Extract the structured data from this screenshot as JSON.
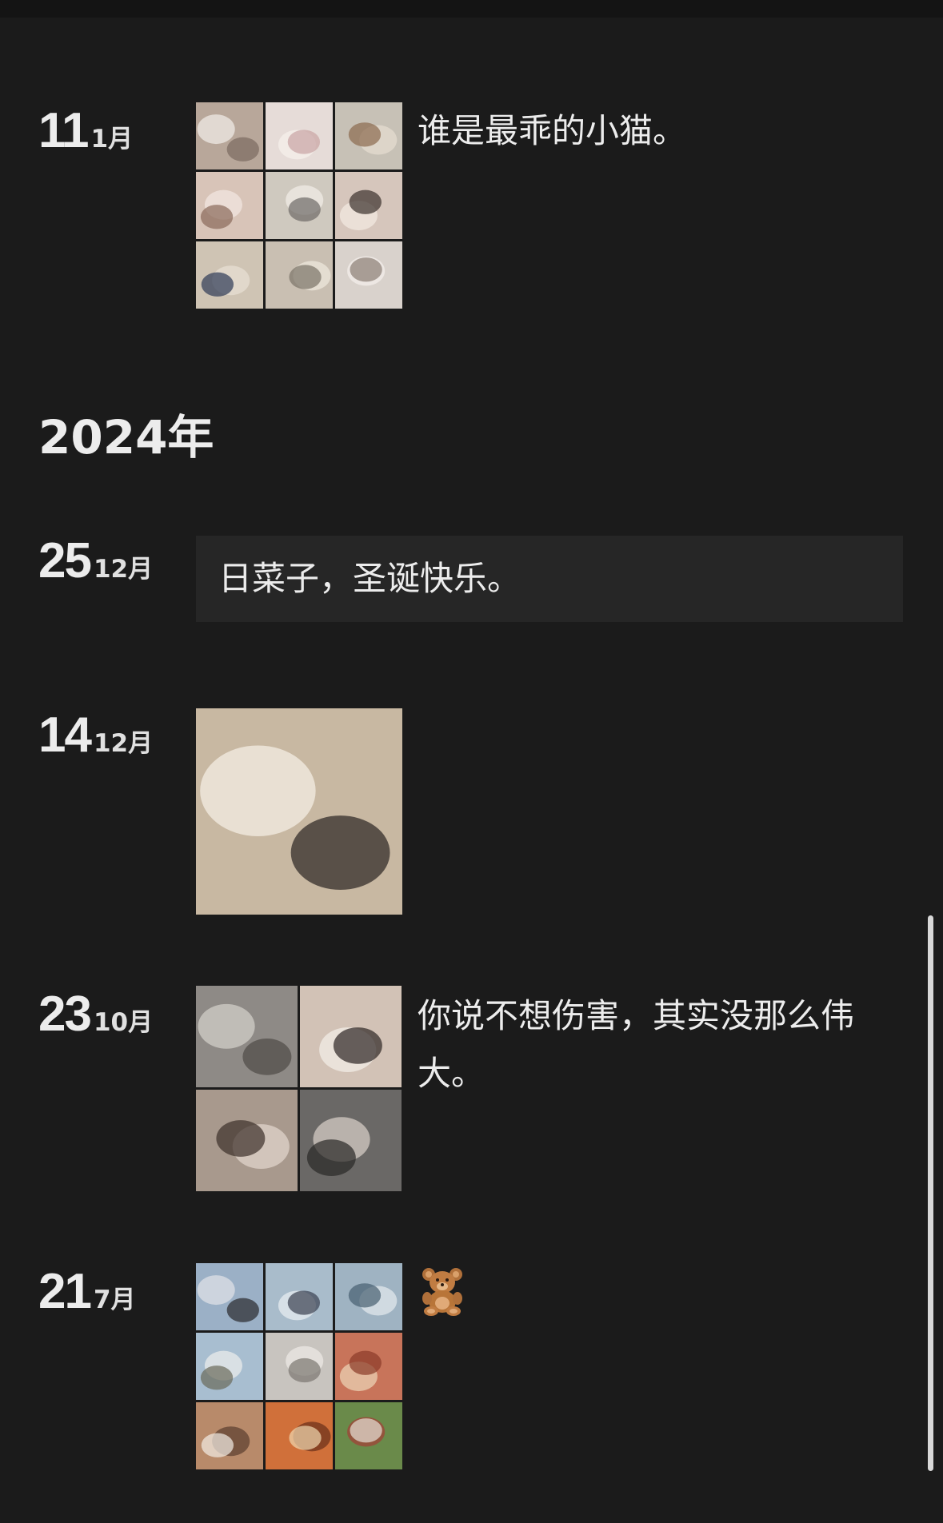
{
  "timeline": {
    "entries_2025": [
      {
        "day": "11",
        "month": "1月",
        "caption": "谁是最乖的小猫。",
        "photos": [
          {
            "name": "photo-cat-kitten",
            "colors": [
              "#b8a79a",
              "#7a6a60",
              "#e8e2dc"
            ]
          },
          {
            "name": "photo-cat-face-closeup",
            "colors": [
              "#e6dcd8",
              "#c9a4a4",
              "#f3ede9"
            ]
          },
          {
            "name": "photo-calico-cat",
            "colors": [
              "#c7c1b6",
              "#8b6a4e",
              "#e0d8cc"
            ]
          },
          {
            "name": "photo-girl-selfie",
            "colors": [
              "#d8c4b8",
              "#8a6a5a",
              "#efe2da"
            ]
          },
          {
            "name": "photo-polaroids",
            "colors": [
              "#cfc9bf",
              "#6d6a66",
              "#ece8e1"
            ]
          },
          {
            "name": "photo-girl-with-cat",
            "colors": [
              "#d6c6bc",
              "#3a302c",
              "#eee4dc"
            ]
          },
          {
            "name": "photo-boy-with-cat",
            "colors": [
              "#cfc4b4",
              "#2e3a55",
              "#e4dccf"
            ]
          },
          {
            "name": "photo-cat-on-blanket",
            "colors": [
              "#c9bfb2",
              "#7b7468",
              "#e9e2d6"
            ]
          },
          {
            "name": "photo-cat-sleeping",
            "colors": [
              "#d9d2cc",
              "#8a7d74",
              "#f0ebe6"
            ]
          }
        ]
      }
    ],
    "year_label": "2024年",
    "entries_2024": [
      {
        "day": "25",
        "month": "12月",
        "text": "日菜子，圣诞快乐。"
      },
      {
        "day": "14",
        "month": "12月",
        "photos": [
          {
            "name": "photo-girl-with-cats-cafe",
            "colors": [
              "#c8b8a2",
              "#2a2422",
              "#eee6dc"
            ]
          }
        ]
      },
      {
        "day": "23",
        "month": "10月",
        "caption": "你说不想伤害，其实没那么伟大。",
        "photos": [
          {
            "name": "photo-cat-and-feet",
            "colors": [
              "#8e8a86",
              "#4e4a46",
              "#c9c5c0"
            ]
          },
          {
            "name": "photo-girl-lying",
            "colors": [
              "#d2c2b6",
              "#2c2524",
              "#efe7e0"
            ]
          },
          {
            "name": "photo-mirror-selfie",
            "colors": [
              "#a8998d",
              "#3c2f2a",
              "#d9cdc3"
            ]
          },
          {
            "name": "photo-cat-and-hand",
            "colors": [
              "#6a6866",
              "#2a2827",
              "#c7bfb8"
            ]
          }
        ]
      },
      {
        "day": "21",
        "month": "7月",
        "emoji": "🧸",
        "emoji_name": "teddy-bear-icon",
        "photos": [
          {
            "name": "photo-airplane-window",
            "colors": [
              "#9bb0c6",
              "#2a2a2c",
              "#d6dbe2"
            ]
          },
          {
            "name": "photo-boat-sea",
            "colors": [
              "#a9bccb",
              "#3a4050",
              "#dfe6ec"
            ]
          },
          {
            "name": "photo-seaside-cafe",
            "colors": [
              "#9fb3c2",
              "#476070",
              "#d8e0e6"
            ]
          },
          {
            "name": "photo-beach-view",
            "colors": [
              "#a8bed0",
              "#6a6a5a",
              "#e2e6e8"
            ]
          },
          {
            "name": "photo-marble-table",
            "colors": [
              "#c8c4bf",
              "#7a7670",
              "#e8e4df"
            ]
          },
          {
            "name": "photo-pizza",
            "colors": [
              "#c8745a",
              "#8a3a28",
              "#e6c6a8"
            ]
          },
          {
            "name": "photo-dessert-plate",
            "colors": [
              "#b88a6a",
              "#f2ede6",
              "#6a4a38"
            ]
          },
          {
            "name": "photo-seafood-dish",
            "colors": [
              "#d0703a",
              "#f0d8b0",
              "#7a3a20"
            ]
          },
          {
            "name": "photo-salad-plate",
            "colors": [
              "#6a8a4a",
              "#e6e0d6",
              "#9a4a3a"
            ]
          }
        ]
      }
    ]
  }
}
